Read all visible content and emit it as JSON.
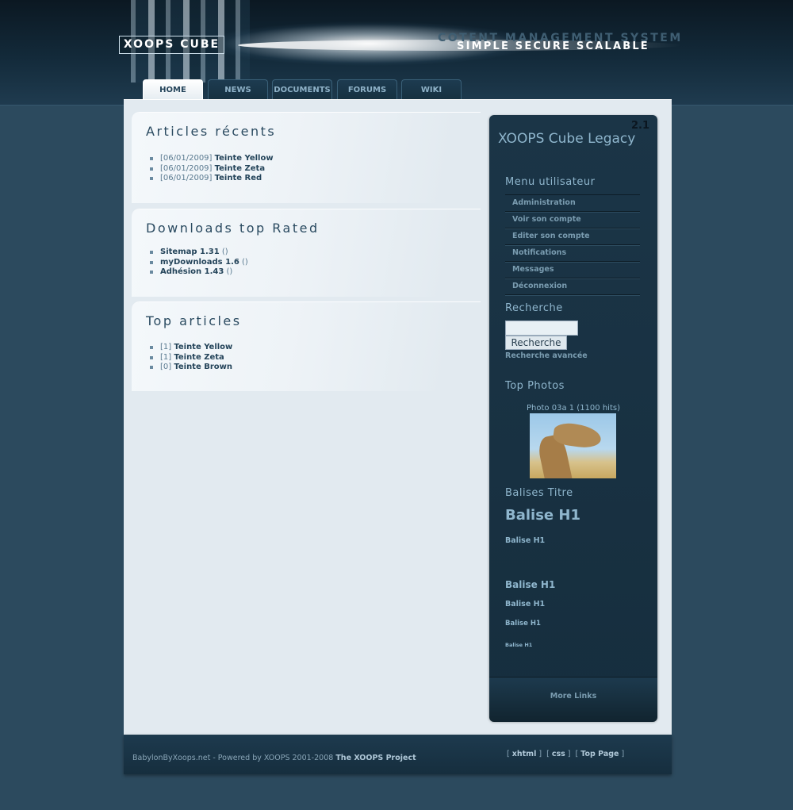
{
  "header": {
    "logo": "XOOPS CUBE",
    "cms_line": "COTENT MANAGEMENT SYSTEM",
    "slogan": "SIMPLE SECURE SCALABLE"
  },
  "tabs": [
    {
      "label": "HOME",
      "active": true
    },
    {
      "label": "NEWS",
      "active": false
    },
    {
      "label": "DOCUMENTS",
      "active": false
    },
    {
      "label": "FORUMS",
      "active": false
    },
    {
      "label": "WIKI",
      "active": false
    }
  ],
  "blocks": {
    "recent": {
      "title": "Articles récents",
      "items": [
        {
          "date": "[06/01/2009]",
          "title": "Teinte Yellow"
        },
        {
          "date": "[06/01/2009]",
          "title": "Teinte Zeta"
        },
        {
          "date": "[06/01/2009]",
          "title": "Teinte Red"
        }
      ]
    },
    "downloads": {
      "title": "Downloads top Rated",
      "items": [
        {
          "title": "Sitemap 1.31",
          "extra": "()"
        },
        {
          "title": "myDownloads 1.6",
          "extra": "()"
        },
        {
          "title": "Adhésion 1.43",
          "extra": "()"
        }
      ]
    },
    "top": {
      "title": "Top articles",
      "items": [
        {
          "count": "[1]",
          "title": "Teinte Yellow"
        },
        {
          "count": "[1]",
          "title": "Teinte Zeta"
        },
        {
          "count": "[0]",
          "title": "Teinte Brown"
        }
      ]
    }
  },
  "sidebar": {
    "version": "2.1",
    "title": "XOOPS Cube Legacy",
    "user_menu_title": "Menu utilisateur",
    "menu": [
      "Administration",
      "Voir son compte",
      "Editer son compte",
      "Notifications",
      "Messages",
      "Déconnexion"
    ],
    "search_title": "Recherche",
    "search_input_value": "",
    "search_button": "Recherche",
    "advanced_search": "Recherche avancée",
    "photos_title": "Top Photos",
    "photo_caption": "Photo 03a 1 (1100 hits)",
    "balises_title": "Balises Titre",
    "balises": [
      "Balise H1",
      "Balise H1",
      "Balise H1",
      "Balise H1",
      "Balise H1",
      "Balise H1"
    ],
    "more_links": "More Links"
  },
  "footer": {
    "text": "BabylonByXoops.net - Powered by XOOPS 2001-2008",
    "project": "The XOOPS Project",
    "links": [
      "xhtml",
      "css",
      "Top Page"
    ]
  }
}
